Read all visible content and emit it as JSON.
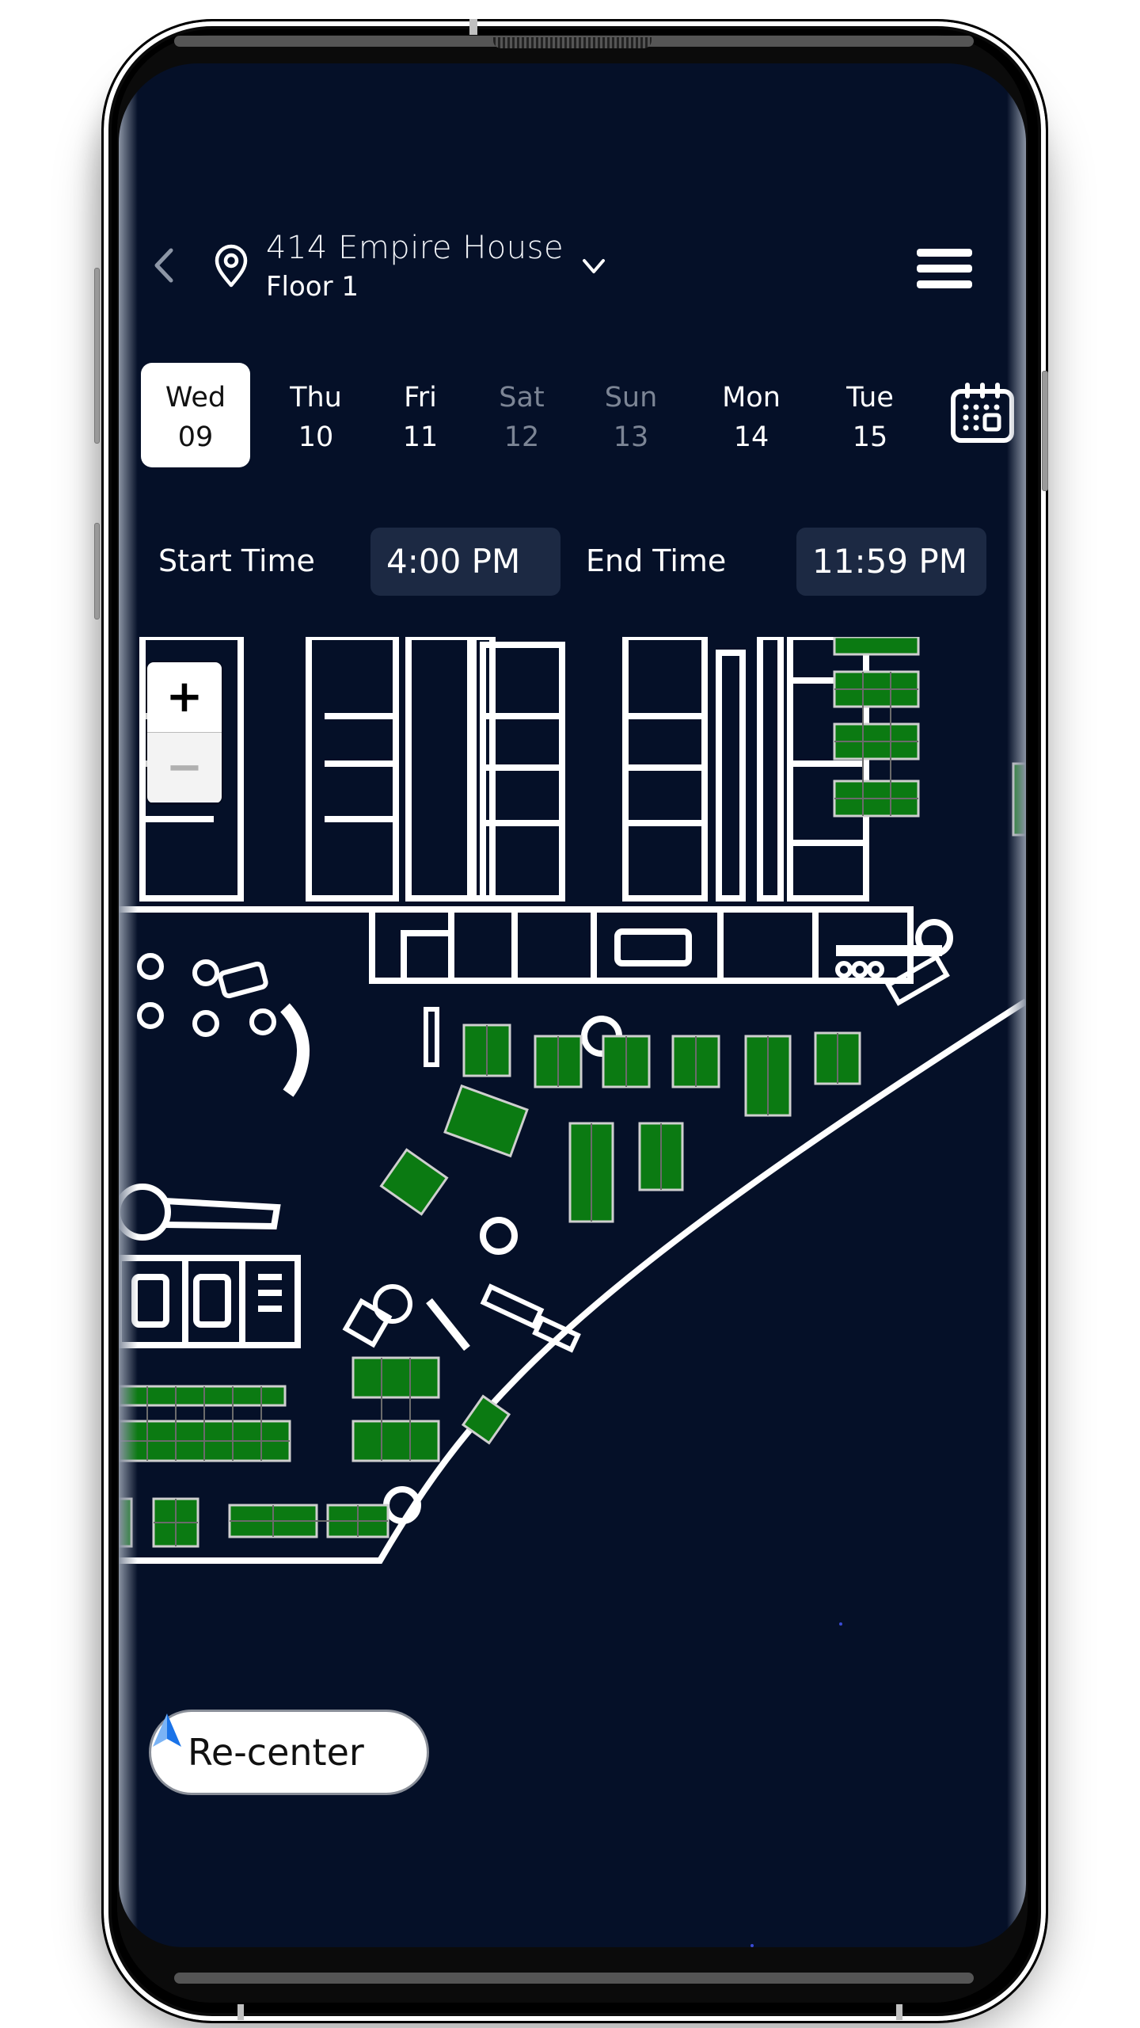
{
  "header": {
    "location_name": "414 Empire House",
    "floor": "Floor 1",
    "icons": {
      "back": "chevron-left-icon",
      "location": "map-pin-icon",
      "dropdown": "chevron-down-icon",
      "menu": "hamburger-menu-icon"
    }
  },
  "date_strip": {
    "days": [
      {
        "name": "Wed",
        "num": "09",
        "selected": true,
        "weekend": false
      },
      {
        "name": "Thu",
        "num": "10",
        "selected": false,
        "weekend": false
      },
      {
        "name": "Fri",
        "num": "11",
        "selected": false,
        "weekend": false
      },
      {
        "name": "Sat",
        "num": "12",
        "selected": false,
        "weekend": true
      },
      {
        "name": "Sun",
        "num": "13",
        "selected": false,
        "weekend": true
      },
      {
        "name": "Mon",
        "num": "14",
        "selected": false,
        "weekend": false
      },
      {
        "name": "Tue",
        "num": "15",
        "selected": false,
        "weekend": false
      }
    ],
    "calendar_icon": "calendar-icon"
  },
  "time": {
    "start_label": "Start Time",
    "start_value": "4:00 PM",
    "end_label": "End Time",
    "end_value": "11:59 PM"
  },
  "map": {
    "zoom_in_label": "+",
    "zoom_out_label": "−",
    "recenter_label": "Re-center",
    "recenter_icon": "navigation-arrow-icon",
    "colors": {
      "background": "#051028",
      "walls": "#ffffff",
      "available_desk": "#0b7a12",
      "desk_outline": "#cfcfcf"
    }
  },
  "theme": {
    "screen_bg": "#051028",
    "time_box_bg": "#1c2943",
    "weekend_text": "#7c8595",
    "accent_blue": "#1a73e8"
  }
}
